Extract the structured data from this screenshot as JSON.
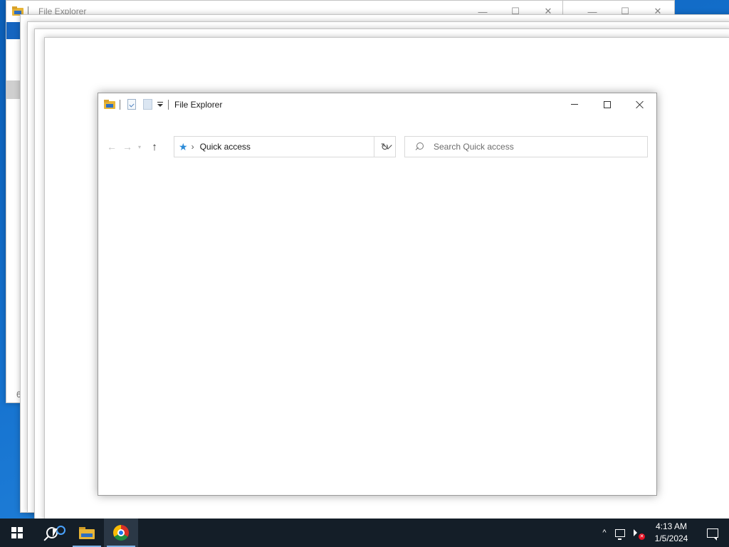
{
  "background_windows": {
    "title": "File Explorer",
    "partial_status_text": "6"
  },
  "window": {
    "title": "File Explorer",
    "controls": {
      "minimize": "minimize",
      "maximize": "maximize",
      "close": "close"
    },
    "quick_access_toolbar": [
      "properties-icon",
      "new-folder-icon",
      "customize-dropdown"
    ]
  },
  "navigation": {
    "address": {
      "location_icon": "quick-access-star-icon",
      "separator": "›",
      "path": "Quick access"
    },
    "refresh_glyph": "↻",
    "search": {
      "placeholder": "Search Quick access",
      "value": ""
    }
  },
  "taskbar": {
    "pinned": [
      {
        "name": "file-explorer",
        "active": false
      },
      {
        "name": "google-chrome",
        "active": true
      }
    ],
    "clock": {
      "time": "4:13 AM",
      "date": "1/5/2024"
    },
    "tray_chevron": "^"
  },
  "colors": {
    "desktop_accent": "#1572cf",
    "taskbar": "#141e28",
    "star_icon": "#2b8bd8",
    "mute_badge": "#e81123"
  }
}
